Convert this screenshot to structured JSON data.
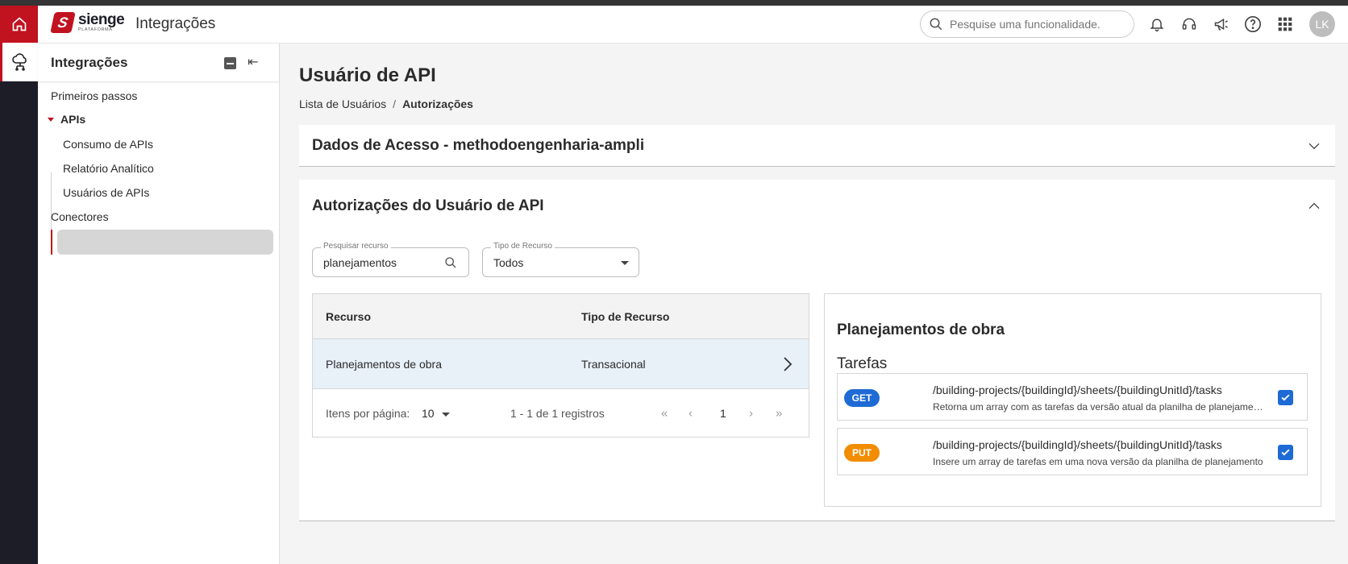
{
  "header": {
    "brand": "sienge",
    "brand_sub": "PLATAFORMA",
    "app_title": "Integrações",
    "search_placeholder": "Pesquise uma funcionalidade.",
    "avatar_initials": "LK"
  },
  "sidebar": {
    "title": "Integrações",
    "items": [
      {
        "label": "Primeiros passos"
      },
      {
        "label": "APIs"
      },
      {
        "label": "Consumo de APIs"
      },
      {
        "label": "Relatório Analítico"
      },
      {
        "label": "Usuários de APIs"
      },
      {
        "label": "Conectores"
      }
    ]
  },
  "main": {
    "title": "Usuário de API",
    "breadcrumb": {
      "parent": "Lista de Usuários",
      "separator": "/",
      "current": "Autorizações"
    },
    "access_card_title": "Dados de Acesso - methodoengenharia-ampli",
    "auth_card_title": "Autorizações do Usuário de API",
    "search_field": {
      "label": "Pesquisar recurso",
      "value": "planejamentos"
    },
    "type_field": {
      "label": "Tipo de Recurso",
      "value": "Todos"
    },
    "table": {
      "columns": [
        "Recurso",
        "Tipo de Recurso"
      ],
      "rows": [
        {
          "resource": "Planejamentos de obra",
          "type": "Transacional"
        }
      ],
      "per_page_label": "Itens por página:",
      "per_page_value": "10",
      "range": "1 - 1 de 1 registros",
      "page": "1"
    },
    "detail": {
      "title": "Planejamentos de obra",
      "subtitle": "Tarefas",
      "endpoints": [
        {
          "method": "GET",
          "color": "#1e6bd6",
          "path": "/building-projects/{buildingId}/sheets/{buildingUnitId}/tasks",
          "description": "Retorna um array com as tarefas da versão atual da planilha de planejamento"
        },
        {
          "method": "PUT",
          "color": "#f28c00",
          "path": "/building-projects/{buildingId}/sheets/{buildingUnitId}/tasks",
          "description": "Insere um array de tarefas em uma nova versão da planilha de planejamento"
        }
      ]
    }
  },
  "colors": {
    "accent": "#c1121f",
    "rail": "#1d1d28",
    "selected_row": "#e8f0f8",
    "checkbox": "#1e6bd6"
  }
}
